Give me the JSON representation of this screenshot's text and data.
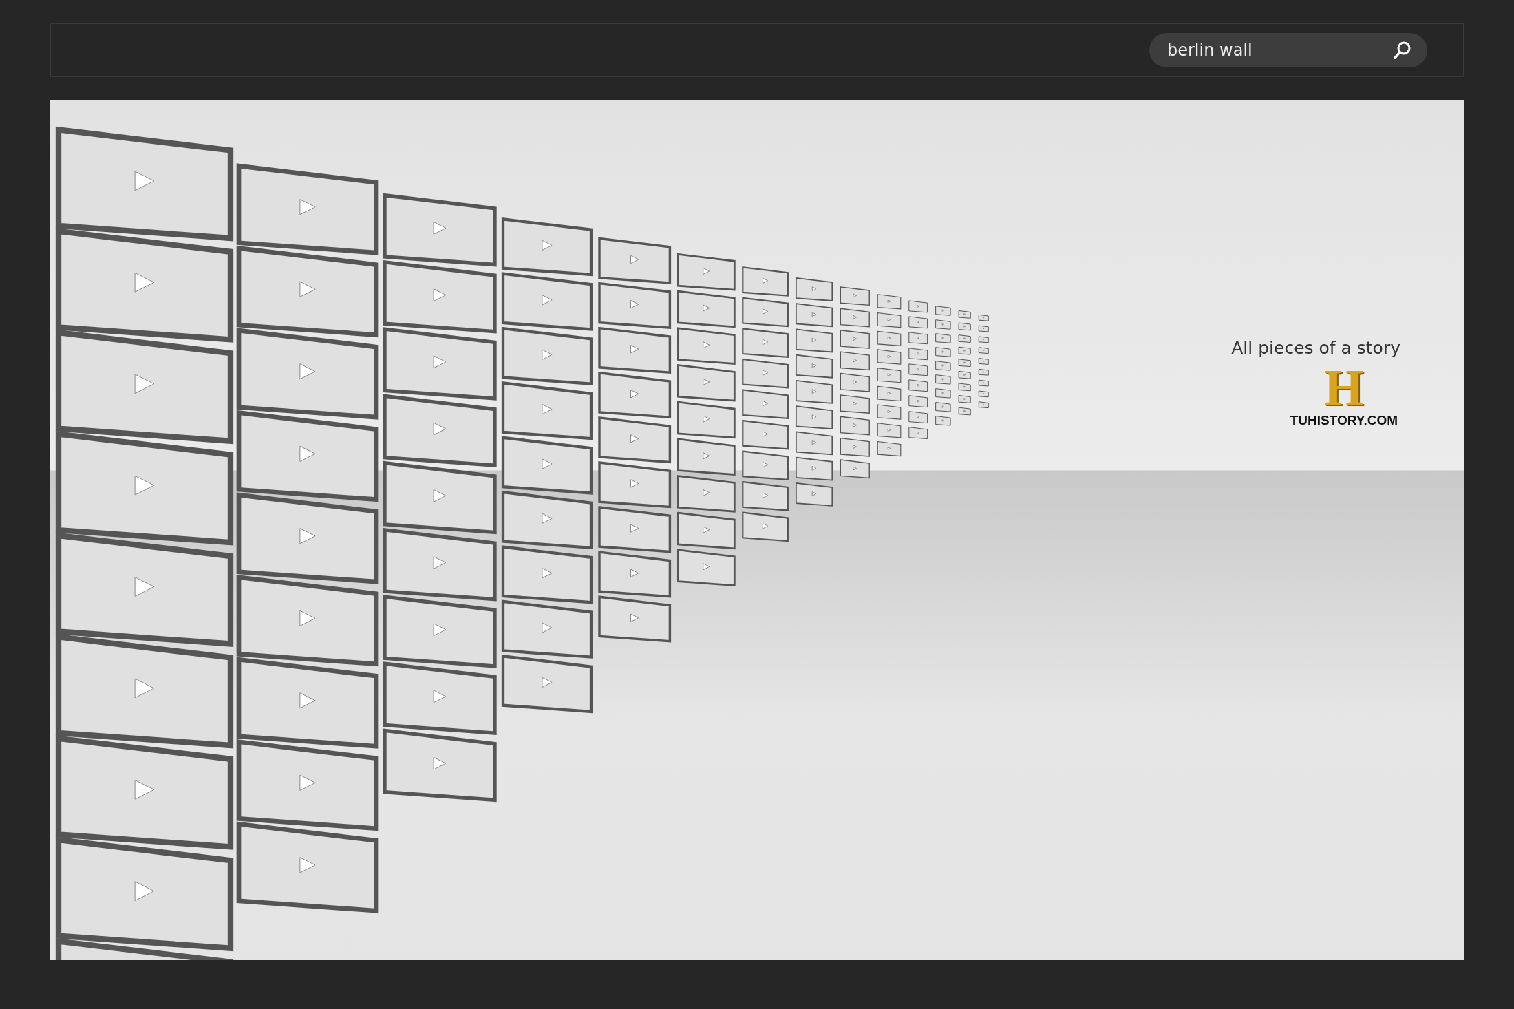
{
  "search": {
    "value": "berlin wall"
  },
  "ad": {
    "tagline": "All pieces of a story",
    "logo_letter": "H",
    "site": "TUHISTORY.COM"
  }
}
